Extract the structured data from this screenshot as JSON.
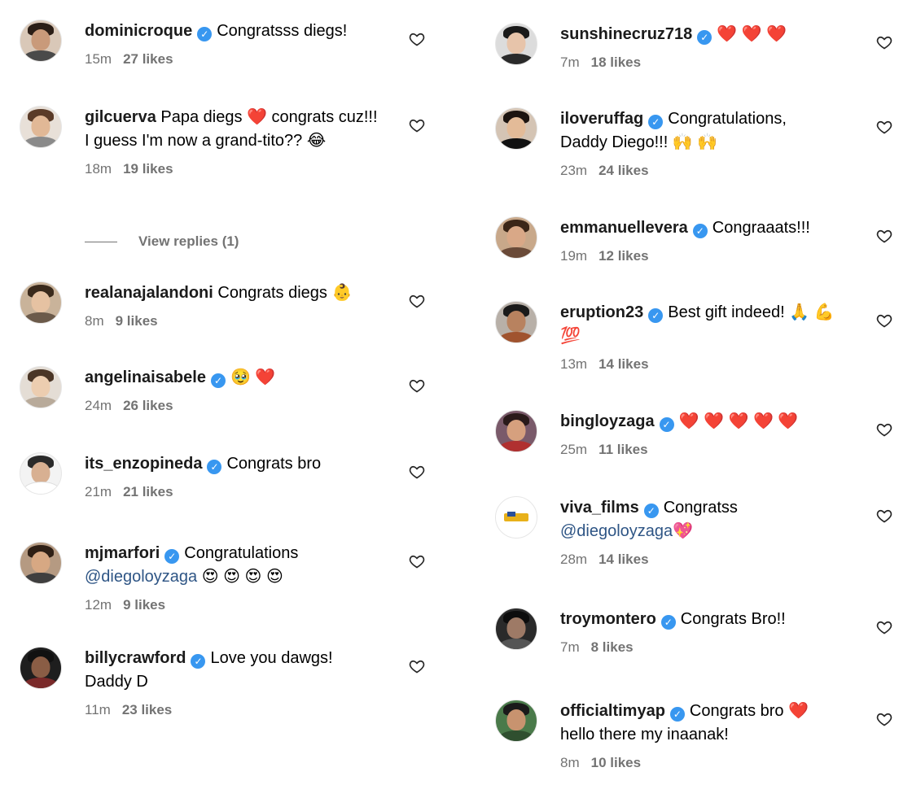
{
  "left": [
    {
      "user": "dominicroque",
      "verified": true,
      "text": "Congratsss diegs!",
      "time": "15m",
      "likes": "27 likes"
    },
    {
      "user": "gilcuerva",
      "verified": false,
      "text": "Papa diegs ❤️ congrats cuz!!! I guess I'm now a grand-tito?? 😂",
      "time": "18m",
      "likes": "19 likes",
      "view_replies": "View replies (1)"
    },
    {
      "user": "realanajalandoni",
      "verified": false,
      "text": "Congrats diegs 👶",
      "time": "8m",
      "likes": "9 likes"
    },
    {
      "user": "angelinaisabele",
      "verified": true,
      "text": "🥹 ❤️",
      "time": "24m",
      "likes": "26 likes"
    },
    {
      "user": "its_enzopineda",
      "verified": true,
      "text": "Congrats bro",
      "time": "21m",
      "likes": "21 likes"
    },
    {
      "user": "mjmarfori",
      "verified": true,
      "text": "Congratulations",
      "mention": "@diegoloyzaga",
      "text_after": " 😍 😍 😍 😍",
      "time": "12m",
      "likes": "9 likes"
    },
    {
      "user": "billycrawford",
      "verified": true,
      "text": "Love you dawgs! Daddy D",
      "time": "11m",
      "likes": "23 likes"
    }
  ],
  "right": [
    {
      "user": "sunshinecruz718",
      "verified": true,
      "text": "❤️ ❤️ ❤️",
      "time": "7m",
      "likes": "18 likes"
    },
    {
      "user": "iloveruffag",
      "verified": true,
      "text": "Congratulations, Daddy Diego!!! 🙌 🙌",
      "time": "23m",
      "likes": "24 likes"
    },
    {
      "user": "emmanuellevera",
      "verified": true,
      "text": "Congraaats!!!",
      "time": "19m",
      "likes": "12 likes"
    },
    {
      "user": "eruption23",
      "verified": true,
      "text": "Best gift indeed! 🙏 💪 💯",
      "time": "13m",
      "likes": "14 likes"
    },
    {
      "user": "bingloyzaga",
      "verified": true,
      "text": "❤️ ❤️ ❤️ ❤️ ❤️",
      "time": "25m",
      "likes": "11 likes"
    },
    {
      "user": "viva_films",
      "verified": true,
      "text": "Congratss",
      "mention": "@diegoloyzaga",
      "text_after": "💖",
      "time": "28m",
      "likes": "14 likes"
    },
    {
      "user": "troymontero",
      "verified": true,
      "text": "Congrats Bro!!",
      "time": "7m",
      "likes": "8 likes"
    },
    {
      "user": "officialtimyap",
      "verified": true,
      "text": "Congrats bro ❤️ hello there my inaanak!",
      "time": "8m",
      "likes": "10 likes"
    }
  ],
  "colors": {
    "verified": "#3897f0",
    "meta_text": "#737373",
    "mention": "#2e5585"
  },
  "icons": {
    "like": "heart-outline-icon",
    "verified": "verified-badge-icon"
  }
}
